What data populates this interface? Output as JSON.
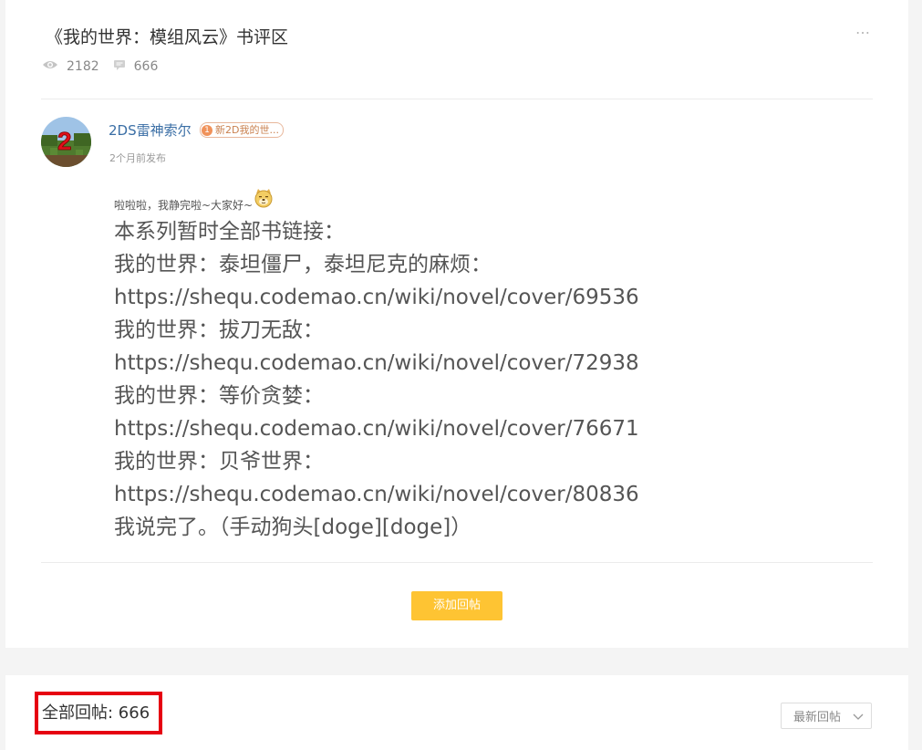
{
  "post": {
    "title": "《我的世界：模组风云》书评区",
    "more_icon": "…",
    "stats": {
      "views": "2182",
      "comments": "666"
    }
  },
  "author": {
    "name": "2DS雷神索尔",
    "badge_level": "1",
    "badge_text": "新2D我的世...",
    "time": "2个月前发布"
  },
  "content": {
    "intro": "啦啦啦，我静完啦~大家好~",
    "lines": [
      "本系列暂时全部书链接：",
      "我的世界：泰坦僵尸，泰坦尼克的麻烦：",
      "https://shequ.codemao.cn/wiki/novel/cover/69536",
      "我的世界：拔刀无敌：",
      "https://shequ.codemao.cn/wiki/novel/cover/72938",
      "我的世界：等价贪婪：",
      "https://shequ.codemao.cn/wiki/novel/cover/76671",
      "我的世界：贝爷世界：",
      "https://shequ.codemao.cn/wiki/novel/cover/80836",
      "我说完了。（手动狗头[doge][doge]）"
    ]
  },
  "actions": {
    "add_reply": "添加回帖"
  },
  "replies": {
    "count_label": "全部回帖: 666",
    "sort_label": "最新回帖"
  },
  "colors": {
    "accent_yellow": "#fec433",
    "author_blue": "#3a6ea5",
    "highlight_red": "#e60012",
    "badge_orange": "#f0925a"
  }
}
